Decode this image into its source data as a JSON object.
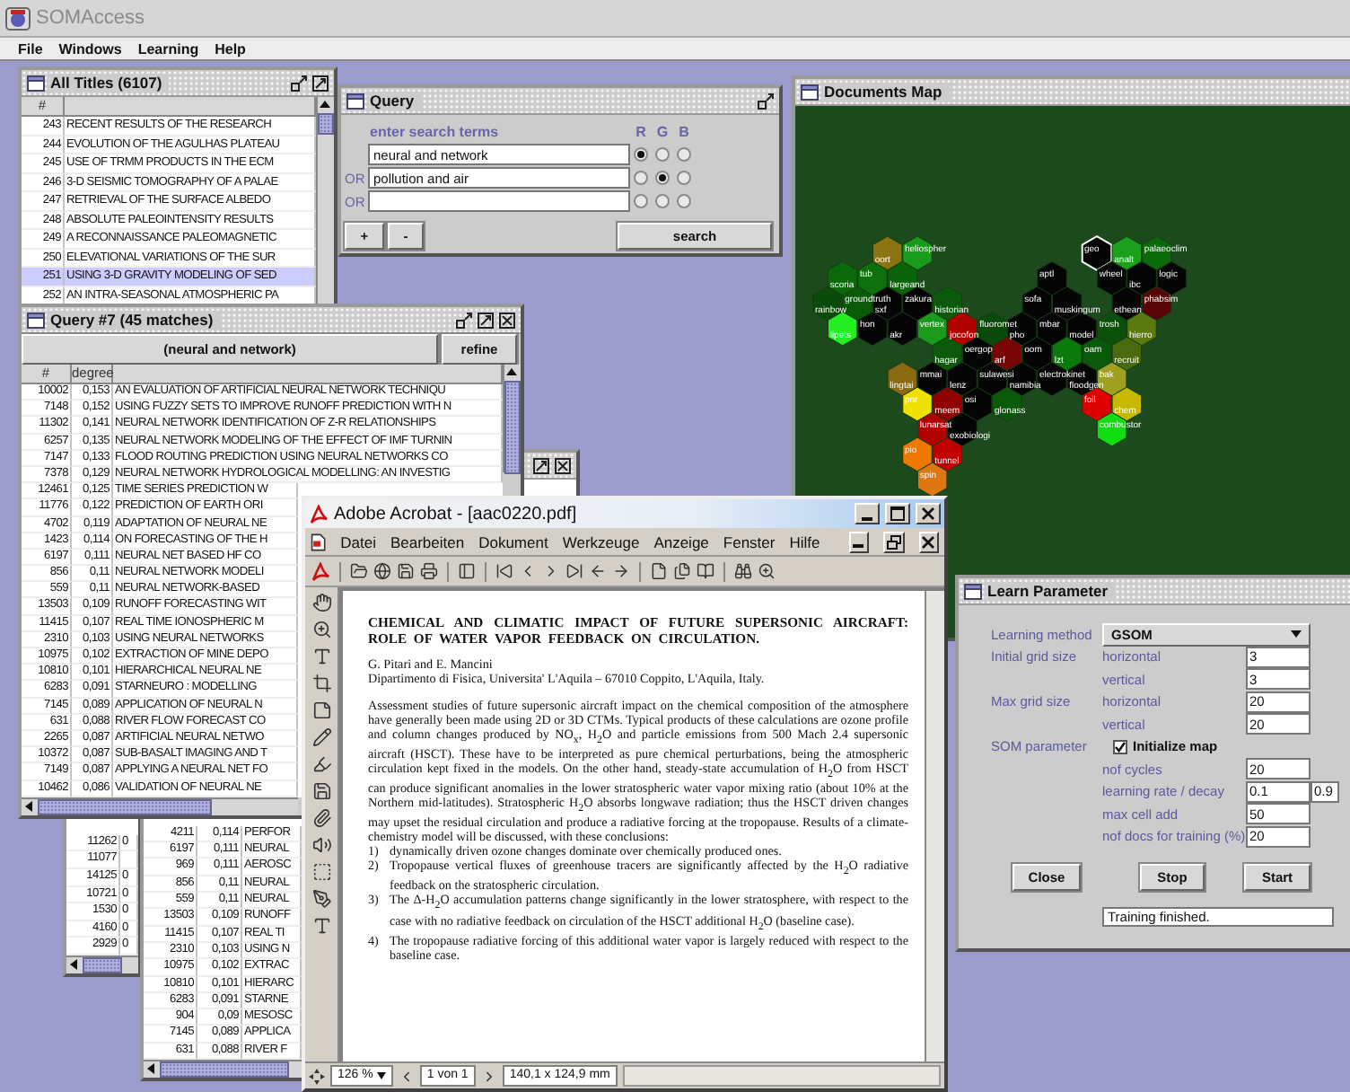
{
  "app": {
    "title": "SOMAccess"
  },
  "menu": [
    "File",
    "Windows",
    "Learning",
    "Help"
  ],
  "all_titles": {
    "title": "All Titles (6107)",
    "columns": [
      "#"
    ],
    "rows": [
      {
        "number": "243",
        "title": "RECENT RESULTS OF THE RESEARCH",
        "selected": false
      },
      {
        "number": "244",
        "title": "EVOLUTION OF THE AGULHAS PLATEAU",
        "selected": false
      },
      {
        "number": "245",
        "title": "USE OF TRMM PRODUCTS IN THE ECM",
        "selected": false
      },
      {
        "number": "246",
        "title": "3-D SEISMIC TOMOGRAPHY OF A PALAE",
        "selected": false
      },
      {
        "number": "247",
        "title": "RETRIEVAL OF THE SURFACE ALBEDO",
        "selected": false
      },
      {
        "number": "248",
        "title": "ABSOLUTE PALEOINTENSITY RESULTS",
        "selected": false
      },
      {
        "number": "249",
        "title": "A RECONNAISSANCE PALEOMAGNETIC",
        "selected": false
      },
      {
        "number": "250",
        "title": "ELEVATIONAL VARIATIONS OF THE SUR",
        "selected": false
      },
      {
        "number": "251",
        "title": "USING 3-D GRAVITY MODELING OF SED",
        "selected": true
      },
      {
        "number": "252",
        "title": "AN INTRA-SEASONAL ATMOSPHERIC PA",
        "selected": false
      }
    ]
  },
  "query": {
    "title": "Query",
    "hint": "enter search terms",
    "channels": [
      "R",
      "G",
      "B"
    ],
    "terms": [
      {
        "value": "neural and network",
        "radios": [
          {
            "selected": true
          },
          {
            "selected": false
          },
          {
            "selected": false
          }
        ]
      },
      {
        "prefix": "OR",
        "value": "pollution and air",
        "radios": [
          {
            "selected": false
          },
          {
            "selected": true
          },
          {
            "selected": false
          }
        ]
      },
      {
        "prefix": "OR",
        "radios": [
          {
            "selected": false
          },
          {
            "selected": false
          },
          {
            "selected": false
          }
        ]
      }
    ],
    "add_button": "+",
    "remove_button": "-",
    "search_button": "search"
  },
  "map": {
    "title": "Documents Map",
    "cells": [
      {
        "label": "oort",
        "color": "#8a7410",
        "selected": false
      },
      {
        "label": "heliospher",
        "color": "#1a9a1a",
        "selected": false
      },
      {
        "label": "geo",
        "color": "#050505",
        "selected": true
      },
      {
        "label": "analt",
        "color": "#1aa01a",
        "selected": false
      },
      {
        "label": "palaeoclim",
        "color": "#0a6a0a",
        "selected": false
      },
      {
        "label": "scoria",
        "color": "#0a6a0a",
        "selected": false
      },
      {
        "label": "tub",
        "color": "#0c700c",
        "selected": false
      },
      {
        "label": "largeand",
        "color": "#0a640a",
        "selected": false
      },
      {
        "label": "aptl",
        "color": "#050505",
        "selected": false
      },
      {
        "label": "wheel",
        "color": "#050505",
        "selected": false
      },
      {
        "label": "ibc",
        "color": "#050505",
        "selected": false
      },
      {
        "label": "logic",
        "color": "#050505",
        "selected": false
      },
      {
        "label": "rainbow",
        "color": "#0a4a0a",
        "selected": false
      },
      {
        "label": "groundtruth",
        "color": "#0a5a0a",
        "selected": false
      },
      {
        "label": "sxf",
        "color": "#050505",
        "selected": false
      },
      {
        "label": "zakura",
        "color": "#050505",
        "selected": false
      },
      {
        "label": "historian",
        "color": "#0a5a0a",
        "selected": false
      },
      {
        "label": "sofa",
        "color": "#050505",
        "selected": false
      },
      {
        "label": "muskingum",
        "color": "#050505",
        "selected": false
      },
      {
        "label": "ethean",
        "color": "#050505",
        "selected": false
      },
      {
        "label": "phabsim",
        "color": "#5a0505",
        "selected": false
      },
      {
        "label": "lipets",
        "color": "#22ee22",
        "selected": false
      },
      {
        "label": "hon",
        "color": "#050505",
        "selected": false
      },
      {
        "label": "akr",
        "color": "#050505",
        "selected": false
      },
      {
        "label": "vertex",
        "color": "#1a9a1a",
        "selected": false
      },
      {
        "label": "jocofon",
        "color": "#b00000",
        "selected": false
      },
      {
        "label": "fluoromet",
        "color": "#0a4a0a",
        "selected": false
      },
      {
        "label": "pho",
        "color": "#050505",
        "selected": false
      },
      {
        "label": "mbar",
        "color": "#050505",
        "selected": false
      },
      {
        "label": "model",
        "color": "#050505",
        "selected": false
      },
      {
        "label": "trosh",
        "color": "#0a500a",
        "selected": false
      },
      {
        "label": "hierro",
        "color": "#5a7a10",
        "selected": false
      },
      {
        "label": "hagar",
        "color": "#0a5a0a",
        "selected": false
      },
      {
        "label": "oergop",
        "color": "#050505",
        "selected": false
      },
      {
        "label": "arf",
        "color": "#7a0505",
        "selected": false
      },
      {
        "label": "oom",
        "color": "#050505",
        "selected": false
      },
      {
        "label": "lzt",
        "color": "#0a7a0a",
        "selected": false
      },
      {
        "label": "oam",
        "color": "#0a5a0a",
        "selected": false
      },
      {
        "label": "recruit",
        "color": "#4a6a10",
        "selected": false
      },
      {
        "label": "lingtai",
        "color": "#8a6a10",
        "selected": false
      },
      {
        "label": "mmai",
        "color": "#050505",
        "selected": false
      },
      {
        "label": "lenz",
        "color": "#050505",
        "selected": false
      },
      {
        "label": "sulawesi",
        "color": "#050505",
        "selected": false
      },
      {
        "label": "namibia",
        "color": "#050505",
        "selected": false
      },
      {
        "label": "electrokinet",
        "color": "#050505",
        "selected": false
      },
      {
        "label": "floodgen",
        "color": "#050505",
        "selected": false
      },
      {
        "label": "bak",
        "color": "#a0a020",
        "selected": false
      },
      {
        "label": "pnr",
        "color": "#f0e000",
        "selected": false
      },
      {
        "label": "meem",
        "color": "#900000",
        "selected": false
      },
      {
        "label": "osi",
        "color": "#050505",
        "selected": false
      },
      {
        "label": "glonass",
        "color": "#0a5a0a",
        "selected": false
      },
      {
        "label": "foil",
        "color": "#dd0000",
        "selected": false
      },
      {
        "label": "chem",
        "color": "#c8b800",
        "selected": false
      },
      {
        "label": "lunarsat",
        "color": "#b00000",
        "selected": false
      },
      {
        "label": "exobiologi",
        "color": "#050505",
        "selected": false
      },
      {
        "label": "combustor",
        "color": "#11dd11",
        "selected": false
      },
      {
        "label": "pio",
        "color": "#ee7700",
        "selected": false
      },
      {
        "label": "tunnel",
        "color": "#c00000",
        "selected": false
      },
      {
        "label": "spin",
        "color": "#dd7711",
        "selected": false
      }
    ]
  },
  "result_list_a": {
    "rows": [
      {
        "number": "11262",
        "column_2": "0"
      },
      {
        "number": "11077"
      },
      {
        "number": "14125",
        "column_2": "0"
      },
      {
        "number": "10721",
        "column_2": "0"
      },
      {
        "number": "1530",
        "column_2": "0"
      },
      {
        "number": "4160",
        "column_2": "0"
      },
      {
        "number": "2929",
        "column_2": "0"
      }
    ]
  },
  "result_list_b": {
    "rows": [
      {
        "number": "4211",
        "degree": "0,114",
        "title": "PERFOR"
      },
      {
        "number": "6197",
        "degree": "0,111",
        "title": "NEURAL"
      },
      {
        "number": "969",
        "degree": "0,111",
        "title": "AEROSC"
      },
      {
        "number": "856",
        "degree": "0,11",
        "title": "NEURAL"
      },
      {
        "number": "559",
        "degree": "0,11",
        "title": "NEURAL"
      },
      {
        "number": "13503",
        "degree": "0,109",
        "title": "RUNOFF"
      },
      {
        "number": "11415",
        "degree": "0,107",
        "title": "REAL TI"
      },
      {
        "number": "2310",
        "degree": "0,103",
        "title": "USING N"
      },
      {
        "number": "10975",
        "degree": "0,102",
        "title": "EXTRAC"
      },
      {
        "number": "10810",
        "degree": "0,101",
        "title": "HIERARC"
      },
      {
        "number": "6283",
        "degree": "0,091",
        "title": "STARNE"
      },
      {
        "number": "904",
        "degree": "0,09",
        "title": "MESOSC"
      },
      {
        "number": "7145",
        "degree": "0,089",
        "title": "APPLICA"
      },
      {
        "number": "631",
        "degree": "0,088",
        "title": "RIVER F"
      }
    ]
  },
  "query_results": {
    "title": "Query #7 (45 matches)",
    "query": "(neural and network)",
    "refine_button": "refine",
    "columns": [
      "#",
      "degree"
    ],
    "rows": [
      {
        "number": "10002",
        "degree": "0,153",
        "title": "AN EVALUATION OF ARTIFICIAL NEURAL NETWORK TECHNIQU"
      },
      {
        "number": "7148",
        "degree": "0,152",
        "title": "USING FUZZY SETS TO IMPROVE RUNOFF PREDICTION WITH N"
      },
      {
        "number": "11302",
        "degree": "0,141",
        "title": "NEURAL NETWORK IDENTIFICATION OF Z-R RELATIONSHIPS"
      },
      {
        "number": "6257",
        "degree": "0,135",
        "title": "NEURAL NETWORK MODELING OF THE EFFECT OF IMF TURNIN"
      },
      {
        "number": "7147",
        "degree": "0,133",
        "title": "FLOOD ROUTING PREDICTION USING NEURAL NETWORKS CO"
      },
      {
        "number": "7378",
        "degree": "0,129",
        "title": "NEURAL NETWORK HYDROLOGICAL MODELLING: AN INVESTIG"
      },
      {
        "number": "12461",
        "degree": "0,125",
        "title": "TIME SERIES PREDICTION W"
      },
      {
        "number": "11776",
        "degree": "0,122",
        "title": "PREDICTION OF EARTH ORI"
      },
      {
        "number": "4702",
        "degree": "0,119",
        "title": "ADAPTATION OF NEURAL NE"
      },
      {
        "number": "1423",
        "degree": "0,114",
        "title": "ON FORECASTING OF THE H"
      },
      {
        "number": "6197",
        "degree": "0,111",
        "title": "NEURAL NET BASED HF CO"
      },
      {
        "number": "856",
        "degree": "0,11",
        "title": "NEURAL NETWORK MODELI"
      },
      {
        "number": "559",
        "degree": "0,11",
        "title": "NEURAL NETWORK-BASED"
      },
      {
        "number": "13503",
        "degree": "0,109",
        "title": "RUNOFF FORECASTING WIT"
      },
      {
        "number": "11415",
        "degree": "0,107",
        "title": "REAL TIME IONOSPHERIC M"
      },
      {
        "number": "2310",
        "degree": "0,103",
        "title": "USING NEURAL NETWORKS"
      },
      {
        "number": "10975",
        "degree": "0,102",
        "title": "EXTRACTION OF MINE DEPO"
      },
      {
        "number": "10810",
        "degree": "0,101",
        "title": "HIERARCHICAL NEURAL NE"
      },
      {
        "number": "6283",
        "degree": "0,091",
        "title": "STARNEURO : MODELLING"
      },
      {
        "number": "7145",
        "degree": "0,089",
        "title": "APPLICATION OF NEURAL N"
      },
      {
        "number": "631",
        "degree": "0,088",
        "title": "RIVER FLOW FORECAST CO"
      },
      {
        "number": "2265",
        "degree": "0,087",
        "title": "ARTIFICIAL NEURAL NETWO"
      },
      {
        "number": "10372",
        "degree": "0,087",
        "title": "SUB-BASALT IMAGING AND T"
      },
      {
        "number": "7149",
        "degree": "0,087",
        "title": "APPLYING A NEURAL NET FO"
      },
      {
        "number": "10462",
        "degree": "0,086",
        "title": "VALIDATION OF NEURAL NE"
      }
    ]
  },
  "acrobat": {
    "title": "Adobe Acrobat - [aac0220.pdf]",
    "menu": [
      "Datei",
      "Bearbeiten",
      "Dokument",
      "Werkzeuge",
      "Anzeige",
      "Fenster",
      "Hilfe"
    ],
    "document": {
      "title": "CHEMICAL AND CLIMATIC IMPACT OF FUTURE SUPERSONIC AIRCRAFT: ROLE OF WATER VAPOR FEEDBACK ON CIRCULATION.",
      "authors": "G. Pitari and E. Mancini",
      "affiliation": "Dipartimento di Fisica, Universita' L'Aquila – 67010 Coppito, L'Aquila, Italy.",
      "paragraph": "Assessment studies of future supersonic aircraft impact on the chemical composition of the atmosphere have generally been made using 2D or 3D CTMs. Typical products of these calculations are ozone profile and column changes produced by NO$_{x}$, H$_{2}$O and particle emissions from 500 Mach 2.4 supersonic aircraft (HSCT). These have to be interpreted as pure chemical perturbations, being the atmospheric circulation kept fixed in the models. On the other hand, steady-state accumulation of H$_{2}$O from HSCT can produce significant anomalies in the lower stratospheric water vapor mixing ratio (about 10% at the Northern mid-latitudes). Stratospheric H$_{2}$O absorbs longwave radiation; thus the HSCT driven changes may upset the residual circulation and produce a radiative forcing at the tropopause. Results of a climate-chemistry model will be discussed, with these conclusions:",
      "findings": [
        {
          "marker": "1)",
          "text": "dynamically driven ozone changes dominate over chemically produced ones."
        },
        {
          "marker": "2)",
          "text": "Tropopause vertical fluxes of greenhouse tracers are significantly affected by the H$_{2}$O radiative feedback on the stratospheric circulation."
        },
        {
          "marker": "3)",
          "text": "The Δ-H$_{2}$O accumulation patterns change significantly in the lower stratosphere, with respect to the case with no radiative feedback on circulation of the HSCT additional H$_{2}$O (baseline case)."
        },
        {
          "marker": "4)",
          "text": "The tropopause radiative forcing of this additional water vapor is largely reduced with respect to the baseline case."
        }
      ]
    },
    "zoom": "126 %",
    "page": "1 von 1",
    "size": "140,1 x 124,9 mm"
  },
  "learn": {
    "title": "Learn Parameter",
    "method_label": "Learning method",
    "method": "GSOM",
    "grid_fields": [
      {
        "group": "Initial grid size",
        "label": "horizontal",
        "value": "3"
      },
      {
        "label": "vertical",
        "value": "3"
      },
      {
        "group": "Max grid size",
        "label": "horizontal",
        "value": "20"
      },
      {
        "label": "vertical",
        "value": "20"
      }
    ],
    "som_label": "SOM parameter",
    "init_map": {
      "label": "Initialize map",
      "checked": true
    },
    "params": [
      {
        "label": "nof cycles",
        "value": "20"
      },
      {
        "label": "learning rate / decay",
        "value": "0.1",
        "value_2": "0.9"
      },
      {
        "label": "max cell add",
        "value": "50"
      },
      {
        "label": "nof docs for training (%)",
        "value": "20"
      }
    ],
    "close_button": "Close",
    "stop_button": "Stop",
    "start_button": "Start",
    "status": "Training finished."
  }
}
